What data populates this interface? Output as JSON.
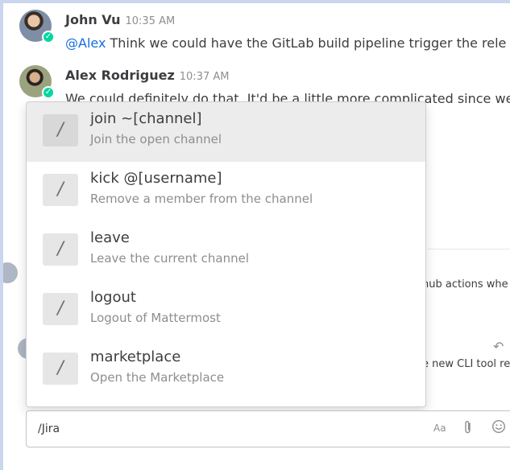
{
  "messages": [
    {
      "author": "John Vu",
      "time": "10:35 AM",
      "mention": "@Alex",
      "text": " Think we could have the GitLab build pipeline trigger the rele"
    },
    {
      "author": "Alex Rodriguez",
      "time": "10:37 AM",
      "mention": "",
      "text": "We could definitely do that. It'd be a little more complicated since we"
    }
  ],
  "background_fragments": {
    "github": "hub actions whe",
    "cli": "e new CLI tool re"
  },
  "suggestions": [
    {
      "icon": "/",
      "command": "join ~[channel]",
      "description": "Join the open channel",
      "selected": true
    },
    {
      "icon": "/",
      "command": "kick @[username]",
      "description": "Remove a member from the channel",
      "selected": false
    },
    {
      "icon": "/",
      "command": "leave",
      "description": "Leave the current channel",
      "selected": false
    },
    {
      "icon": "/",
      "command": "logout",
      "description": "Logout of Mattermost",
      "selected": false
    },
    {
      "icon": "/",
      "command": "marketplace",
      "description": "Open the Marketplace",
      "selected": false
    }
  ],
  "composer": {
    "value": "/Jira",
    "format_label": "Aa",
    "attach_icon": "paperclip-icon",
    "emoji_icon": "emoji-icon"
  },
  "colors": {
    "mention": "#166de0",
    "online_status": "#06d6a0",
    "selected_row": "#ececec"
  }
}
